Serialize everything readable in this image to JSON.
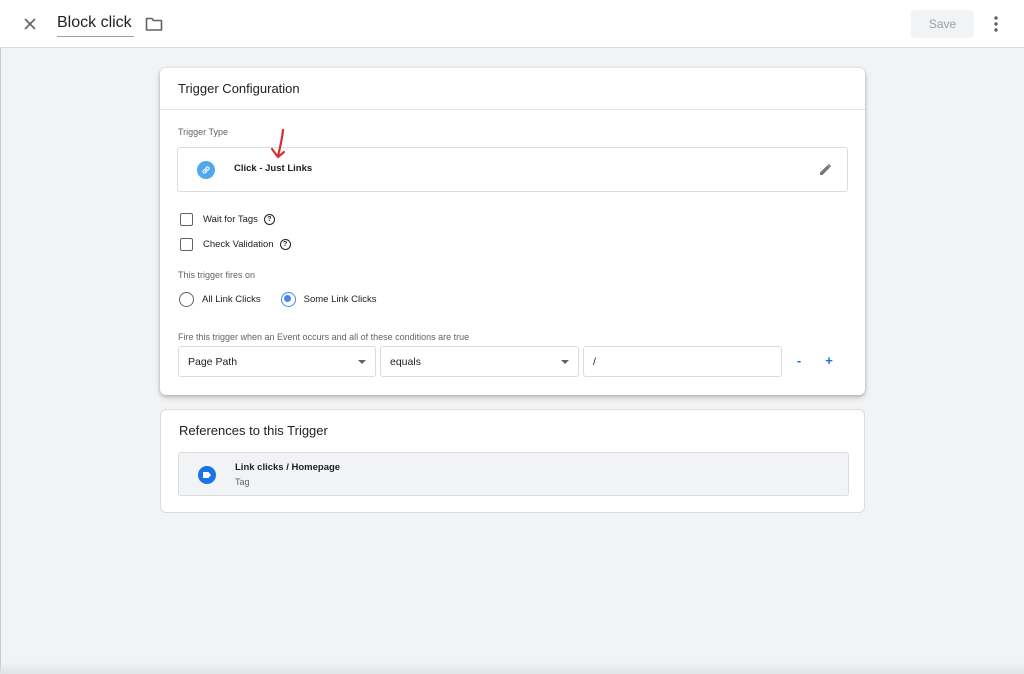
{
  "topbar": {
    "title": "Block click",
    "save_label": "Save",
    "close_icon": "close-icon",
    "folder_icon": "folder-icon",
    "more_icon": "more-vert-icon"
  },
  "config": {
    "header": "Trigger Configuration",
    "trigger_type_label": "Trigger Type",
    "trigger_type": "Click - Just Links",
    "trigger_type_icon": "link-icon",
    "wait_for_tags": {
      "label": "Wait for Tags",
      "checked": false
    },
    "check_validation": {
      "label": "Check Validation",
      "checked": false
    },
    "fires_on_label": "This trigger fires on",
    "fires_on_options": [
      {
        "label": "All Link Clicks",
        "selected": false
      },
      {
        "label": "Some Link Clicks",
        "selected": true
      }
    ],
    "conditions_label": "Fire this trigger when an Event occurs and all of these conditions are true",
    "condition": {
      "variable": "Page Path",
      "operator": "equals",
      "value": "/"
    },
    "remove_label": "-",
    "add_label": "+"
  },
  "references": {
    "header": "References to this Trigger",
    "items": [
      {
        "title": "Link clicks / Homepage",
        "subtitle": "Tag",
        "icon": "tag-icon"
      }
    ]
  },
  "colors": {
    "accent": "#1a73e8",
    "radio": "#4285f4",
    "trigger_icon_bg": "#4fa9ef",
    "annotation_arrow": "#d32f2f"
  }
}
